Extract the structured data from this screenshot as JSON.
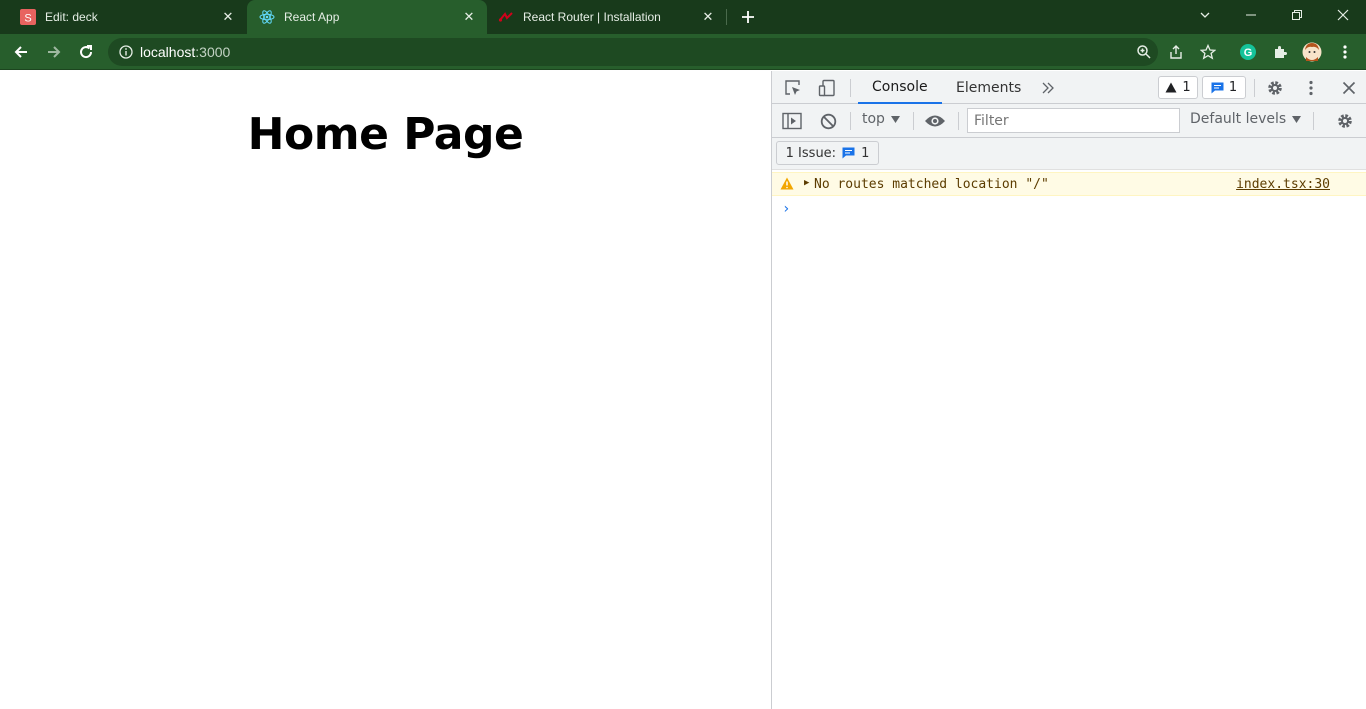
{
  "browser": {
    "tabs": [
      {
        "title": "Edit: deck",
        "favicon": "slides-s-icon",
        "active": false
      },
      {
        "title": "React App",
        "favicon": "react-atom-icon",
        "active": true
      },
      {
        "title": "React Router | Installation",
        "favicon": "react-router-icon",
        "active": false
      }
    ],
    "address": {
      "host": "localhost",
      "port": ":3000"
    },
    "colors": {
      "frame": "#183a1b",
      "toolbar": "#275e2c",
      "omnibox": "#1e4a22"
    }
  },
  "page": {
    "heading": "Home Page"
  },
  "devtools": {
    "tabs": [
      "Console",
      "Elements"
    ],
    "active_tab": "Console",
    "warning_count": "1",
    "issue_count": "1",
    "context": "top",
    "filter_placeholder": "Filter",
    "levels": "Default levels",
    "issues_label": "1 Issue:",
    "issues_badge": "1",
    "messages": [
      {
        "level": "warning",
        "text": "No routes matched location \"/\"",
        "source": "index.tsx:30"
      }
    ]
  }
}
